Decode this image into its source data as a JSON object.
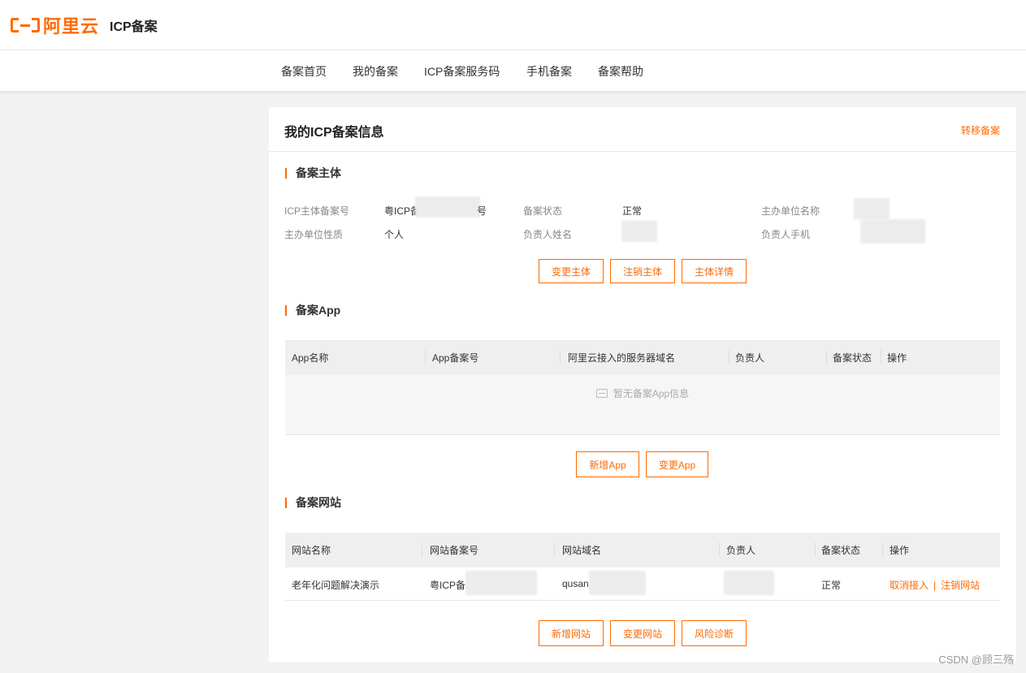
{
  "brand": {
    "logo_text": "阿里云",
    "app_title": "ICP备案"
  },
  "nav": [
    "备案首页",
    "我的备案",
    "ICP备案服务码",
    "手机备案",
    "备案帮助"
  ],
  "card": {
    "title": "我的ICP备案信息",
    "transfer_link": "转移备案"
  },
  "subject": {
    "section_title": "备案主体",
    "fields": [
      {
        "label": "ICP主体备案号",
        "value": "粤ICP备",
        "suffix": "号"
      },
      {
        "label": "备案状态",
        "value": "正常"
      },
      {
        "label": "主办单位名称",
        "value": ""
      },
      {
        "label": "主办单位性质",
        "value": "个人"
      },
      {
        "label": "负责人姓名",
        "value": ""
      },
      {
        "label": "负责人手机",
        "value": ""
      }
    ],
    "buttons": [
      "变更主体",
      "注销主体",
      "主体详情"
    ]
  },
  "app": {
    "section_title": "备案App",
    "columns": [
      "App名称",
      "App备案号",
      "阿里云接入的服务器域名",
      "负责人",
      "备案状态",
      "操作"
    ],
    "empty_text": "暂无备案App信息",
    "buttons": [
      "新增App",
      "变更App"
    ]
  },
  "website": {
    "section_title": "备案网站",
    "columns": [
      "网站名称",
      "网站备案号",
      "网站域名",
      "负责人",
      "备案状态",
      "操作"
    ],
    "rows": [
      {
        "name": "老年化问题解决演示",
        "record_no": "粤ICP备",
        "domain": "qusan",
        "owner": "",
        "status": "正常",
        "actions": [
          "取消接入",
          "注销网站"
        ]
      }
    ],
    "buttons": [
      "新增网站",
      "变更网站",
      "风险诊断"
    ]
  },
  "watermark": "CSDN @顾三殇",
  "colors": {
    "accent": "#ff6a00",
    "background": "#f2f2f2"
  }
}
